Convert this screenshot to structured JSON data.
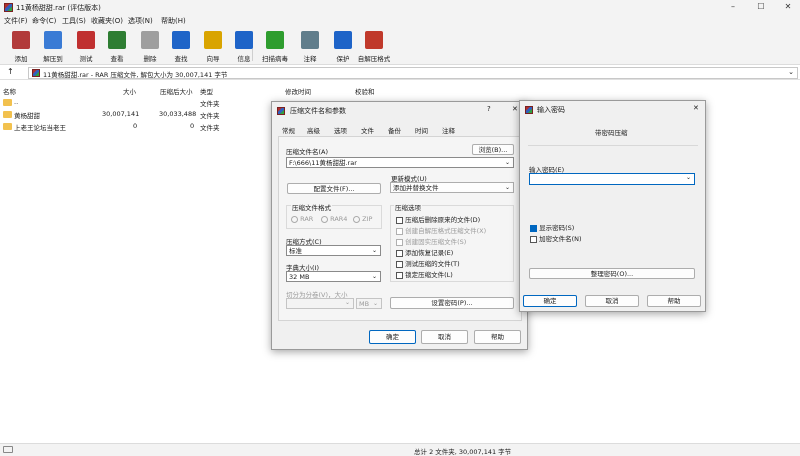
{
  "window": {
    "title": "11黄杨甜甜.rar (评估版本)"
  },
  "menu": [
    "文件(F)",
    "命令(C)",
    "工具(S)",
    "收藏夹(O)",
    "选项(N)",
    "帮助(H)"
  ],
  "toolbar": {
    "buttons": [
      {
        "label": "添加",
        "icon": "add-archive-icon",
        "color": "#b23b3b"
      },
      {
        "label": "解压到",
        "icon": "extract-folder-icon",
        "color": "#3a7bd5"
      },
      {
        "label": "测试",
        "icon": "test-checklist-icon",
        "color": "#c03030"
      },
      {
        "label": "查看",
        "icon": "view-book-icon",
        "color": "#2e7d32"
      },
      {
        "label": "删除",
        "icon": "trash-icon",
        "color": "#9e9e9e"
      },
      {
        "label": "查找",
        "icon": "magnifier-icon",
        "color": "#1e64c8"
      },
      {
        "label": "向导",
        "icon": "wizard-wand-icon",
        "color": "#d9a400"
      },
      {
        "label": "信息",
        "icon": "info-icon",
        "color": "#1e64c8"
      },
      {
        "label": "扫描病毒",
        "icon": "virus-scan-icon",
        "color": "#2e9d2e"
      },
      {
        "label": "注释",
        "icon": "comment-icon",
        "color": "#607d8b"
      },
      {
        "label": "保护",
        "icon": "shield-icon",
        "color": "#1e64c8"
      },
      {
        "label": "自解压格式",
        "icon": "sfx-archive-icon",
        "color": "#c0392b"
      }
    ]
  },
  "address": {
    "up_arrow": "↑",
    "text": "11黄杨甜甜.rar - RAR 压缩文件, 解包大小为 30,007,141 字节"
  },
  "filelist": {
    "columns": [
      "名称",
      "大小",
      "压缩后大小",
      "类型",
      "修改时间",
      "校验和"
    ],
    "rows": [
      {
        "name": "..",
        "size": "",
        "packed": "",
        "type": "文件夹"
      },
      {
        "name": "黄杨甜甜",
        "size": "30,007,141",
        "packed": "30,033,488",
        "type": "文件夹"
      },
      {
        "name": "上老王论坛当老王",
        "size": "0",
        "packed": "0",
        "type": "文件夹"
      }
    ]
  },
  "status": {
    "text": "总计 2 文件夹, 30,007,141 字节"
  },
  "archive_dialog": {
    "title": "压缩文件名和参数",
    "help_q": "?",
    "close": "✕",
    "tabs": [
      "常规",
      "高级",
      "选项",
      "文件",
      "备份",
      "时间",
      "注释"
    ],
    "archive_name_label": "压缩文件名(A)",
    "browse": "浏览(B)...",
    "archive_name_value": "F:\\666\\11黄杨甜甜.rar",
    "profiles": "配置文件(F)...",
    "update_mode_label": "更新模式(U)",
    "update_mode_value": "添加并替换文件",
    "format_label": "压缩文件格式",
    "formats": [
      "RAR",
      "RAR4",
      "ZIP"
    ],
    "options_label": "压缩选项",
    "options": [
      {
        "label": "压缩后删除原来的文件(D)",
        "enabled": true
      },
      {
        "label": "创建自解压格式压缩文件(X)",
        "enabled": false
      },
      {
        "label": "创建固实压缩文件(S)",
        "enabled": false
      },
      {
        "label": "添加恢复记录(E)",
        "enabled": true
      },
      {
        "label": "测试压缩的文件(T)",
        "enabled": true
      },
      {
        "label": "锁定压缩文件(L)",
        "enabled": true
      }
    ],
    "method_label": "压缩方式(C)",
    "method_value": "标准",
    "dict_label": "字典大小(I)",
    "dict_value": "32 MB",
    "split_label": "切分为分卷(V)，大小",
    "split_unit": "MB",
    "set_password": "设置密码(P)...",
    "ok": "确定",
    "cancel": "取消",
    "help": "帮助"
  },
  "password_dialog": {
    "title": "输入密码",
    "close": "✕",
    "header": "带密码压缩",
    "password_label": "输入密码(E)",
    "show_password": "显示密码(S)",
    "encrypt_names": "加密文件名(N)",
    "organize": "整理密码(O)...",
    "ok": "确定",
    "cancel": "取消",
    "help": "帮助"
  }
}
